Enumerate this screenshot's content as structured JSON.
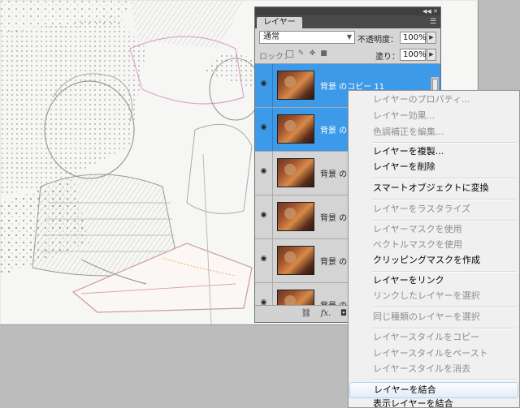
{
  "layers_panel": {
    "tab_label": "レイヤー",
    "collapse_icon": "double-arrow-icon",
    "close_icon": "close-icon",
    "menu_icon": "panel-menu-icon",
    "blend_mode": "通常",
    "opacity_label": "不透明度：",
    "opacity_value": "100%",
    "lock_label": "ロック：",
    "fill_label": "塗り：",
    "fill_value": "100%",
    "layers": [
      {
        "name": "背景 のコピー 11",
        "selected": true
      },
      {
        "name": "背景 のコ",
        "selected": true
      },
      {
        "name": "背景 のコ",
        "selected": false
      },
      {
        "name": "背景 のコ",
        "selected": false
      },
      {
        "name": "背景 のコ",
        "selected": false
      },
      {
        "name": "背景 のコ",
        "selected": false
      }
    ],
    "footer_icons": [
      "link-icon",
      "fx-icon",
      "mask-icon"
    ],
    "footer_fx_label": "fx."
  },
  "context_menu": {
    "items": [
      {
        "label": "レイヤーのプロパティ...",
        "enabled": false
      },
      {
        "label": "レイヤー効果...",
        "enabled": false
      },
      {
        "label": "色調補正を編集...",
        "enabled": false
      },
      {
        "label": "レイヤーを複製...",
        "enabled": true
      },
      {
        "label": "レイヤーを削除",
        "enabled": true
      },
      {
        "label": "スマートオブジェクトに変換",
        "enabled": true
      },
      {
        "label": "レイヤーをラスタライズ",
        "enabled": false
      },
      {
        "label": "レイヤーマスクを使用",
        "enabled": false
      },
      {
        "label": "ベクトルマスクを使用",
        "enabled": false
      },
      {
        "label": "クリッピングマスクを作成",
        "enabled": true
      },
      {
        "label": "レイヤーをリンク",
        "enabled": true
      },
      {
        "label": "リンクしたレイヤーを選択",
        "enabled": false
      },
      {
        "label": "同じ種類のレイヤーを選択",
        "enabled": false
      },
      {
        "label": "レイヤースタイルをコピー",
        "enabled": false
      },
      {
        "label": "レイヤースタイルをペースト",
        "enabled": false
      },
      {
        "label": "レイヤースタイルを消去",
        "enabled": false
      },
      {
        "label": "レイヤーを結合",
        "enabled": true,
        "highlighted": true
      },
      {
        "label": "表示レイヤーを結合",
        "enabled": true
      }
    ]
  },
  "colors": {
    "selection_blue": "#3d9ae8",
    "panel_gray": "#d6d6d6",
    "workspace_gray": "#bcbcbc"
  }
}
